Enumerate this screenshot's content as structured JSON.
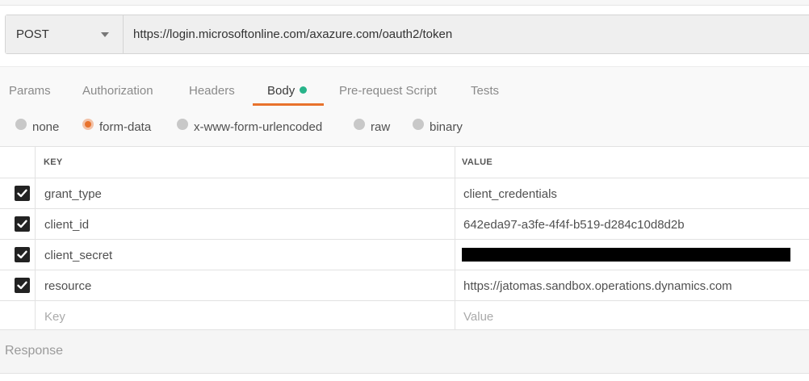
{
  "request": {
    "method": "POST",
    "url": "https://login.microsoftonline.com/axazure.com/oauth2/token"
  },
  "tabs": [
    {
      "label": "Params"
    },
    {
      "label": "Authorization"
    },
    {
      "label": "Headers"
    },
    {
      "label": "Body",
      "active": true,
      "indicator_color": "#28b48a"
    },
    {
      "label": "Pre-request Script"
    },
    {
      "label": "Tests"
    }
  ],
  "body_types": [
    {
      "label": "none"
    },
    {
      "label": "form-data",
      "selected": true
    },
    {
      "label": "x-www-form-urlencoded"
    },
    {
      "label": "raw"
    },
    {
      "label": "binary"
    }
  ],
  "table": {
    "headers": {
      "key": "KEY",
      "value": "VALUE"
    },
    "rows": [
      {
        "checked": true,
        "key": "grant_type",
        "value": "client_credentials"
      },
      {
        "checked": true,
        "key": "client_id",
        "value": "642eda97-a3fe-4f4f-b519-d284c10d8d2b"
      },
      {
        "checked": true,
        "key": "client_secret",
        "value": "",
        "redacted": true
      },
      {
        "checked": true,
        "key": "resource",
        "value": "https://jatomas.sandbox.operations.dynamics.com"
      }
    ],
    "new_row": {
      "key_placeholder": "Key",
      "value_placeholder": "Value"
    }
  },
  "response": {
    "label": "Response"
  },
  "colors": {
    "accent": "#e8722c",
    "indicator": "#28b48a"
  }
}
